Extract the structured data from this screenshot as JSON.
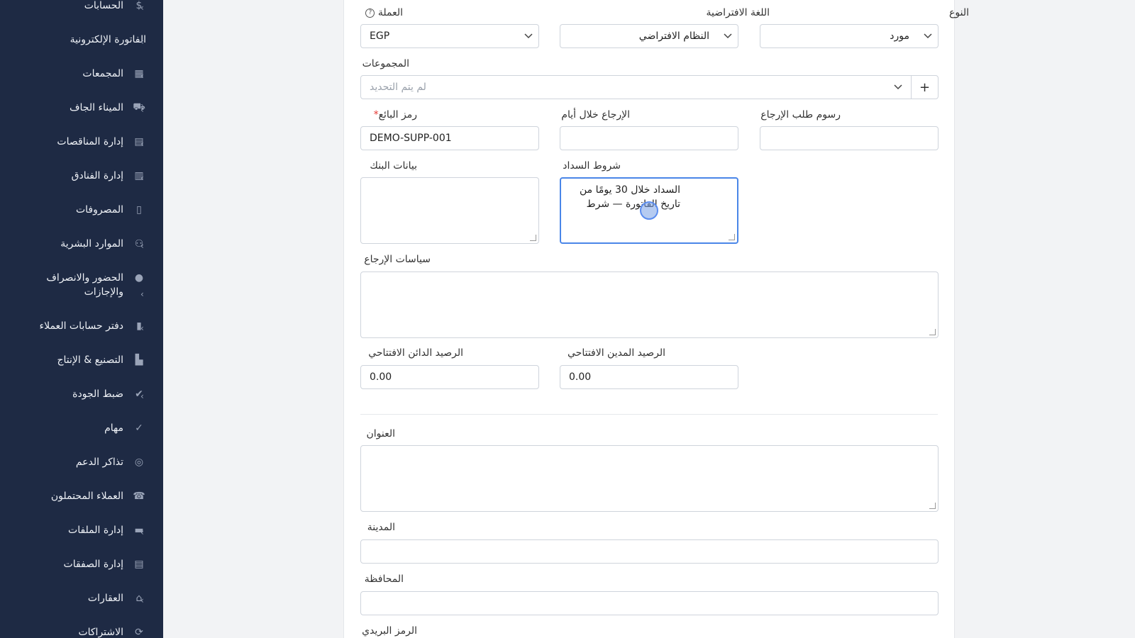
{
  "sidebar": {
    "items": [
      {
        "label": "الحسابات",
        "icon": "dollar-icon",
        "glyph": "$",
        "chevron": true
      },
      {
        "label": "الفاتورة الإلكترونية",
        "icon": "none",
        "glyph": "",
        "chevron": true
      },
      {
        "label": "المجمعات",
        "icon": "buildings-icon",
        "glyph": "▦",
        "chevron": true
      },
      {
        "label": "الميناء الجاف",
        "icon": "truck-icon",
        "glyph": "⛟",
        "chevron": true
      },
      {
        "label": "إدارة المناقصات",
        "icon": "document-icon",
        "glyph": "▤",
        "chevron": true
      },
      {
        "label": "إدارة الفنادق",
        "icon": "hotel-icon",
        "glyph": "▥",
        "chevron": true
      },
      {
        "label": "المصروفات",
        "icon": "receipt-icon",
        "glyph": "▯",
        "chevron": false
      },
      {
        "label": "الموارد البشرية",
        "icon": "users-icon",
        "glyph": "⚇",
        "chevron": true
      },
      {
        "label": "الحضور والانصراف والإجازات",
        "icon": "user-circle-icon",
        "glyph": "●",
        "chevron": true
      },
      {
        "label": "دفتر حسابات العملاء",
        "icon": "bookmark-icon",
        "glyph": "▮",
        "chevron": true
      },
      {
        "label": "التصنيع & الإنتاج",
        "icon": "factory-icon",
        "glyph": "▙",
        "chevron": true
      },
      {
        "label": "ضبط الجودة",
        "icon": "check-circle-icon",
        "glyph": "✔",
        "chevron": true
      },
      {
        "label": "مهام",
        "icon": "tasks-icon",
        "glyph": "✓",
        "chevron": false
      },
      {
        "label": "تذاكر الدعم",
        "icon": "lifebuoy-icon",
        "glyph": "◎",
        "chevron": false
      },
      {
        "label": "العملاء المحتملون",
        "icon": "phone-icon",
        "glyph": "☎",
        "chevron": false
      },
      {
        "label": "إدارة الملفات",
        "icon": "folder-icon",
        "glyph": "▬",
        "chevron": true
      },
      {
        "label": "إدارة الصفقات",
        "icon": "list-icon",
        "glyph": "▤",
        "chevron": false
      },
      {
        "label": "العقارات",
        "icon": "home-icon",
        "glyph": "⌂",
        "chevron": true
      },
      {
        "label": "الاشتراكات",
        "icon": "refresh-icon",
        "glyph": "⟳",
        "chevron": false
      }
    ]
  },
  "form": {
    "type": {
      "label": "النوع",
      "value": "مورد"
    },
    "default_language": {
      "label": "اللغة الافتراضية",
      "value": "النظام الافتراضي"
    },
    "currency": {
      "label": "العملة",
      "value": "EGP",
      "help_glyph": "?"
    },
    "groups": {
      "label": "المجموعات",
      "placeholder": "لم يتم التحديد",
      "add_glyph": "+"
    },
    "return_request_fee": {
      "label": "رسوم طلب الإرجاع",
      "value": ""
    },
    "return_within_days": {
      "label": "الإرجاع خلال أيام",
      "value": ""
    },
    "vendor_code": {
      "label": "رمز البائع",
      "required_mark": "*",
      "value": "DEMO-SUPP-001"
    },
    "payment_terms": {
      "label": "شروط السداد",
      "value": "السداد خلال 30 يومًا من تاريخ الفاتورة — شرط"
    },
    "bank_details": {
      "label": "بيانات البنك",
      "value": ""
    },
    "return_policies": {
      "label": "سياسات الإرجاع",
      "value": ""
    },
    "opening_debit_balance": {
      "label": "الرصيد المدين الافتتاحي",
      "value": "0.00"
    },
    "opening_credit_balance": {
      "label": "الرصيد الدائن الافتتاحي",
      "value": "0.00"
    },
    "address": {
      "label": "العنوان",
      "value": ""
    },
    "city": {
      "label": "المدينة",
      "value": ""
    },
    "governorate": {
      "label": "المحافظة",
      "value": ""
    },
    "postal_code": {
      "label": "الرمز البريدي"
    }
  },
  "ui": {
    "chevron_left": "‹",
    "chevron_down": "⌄"
  }
}
